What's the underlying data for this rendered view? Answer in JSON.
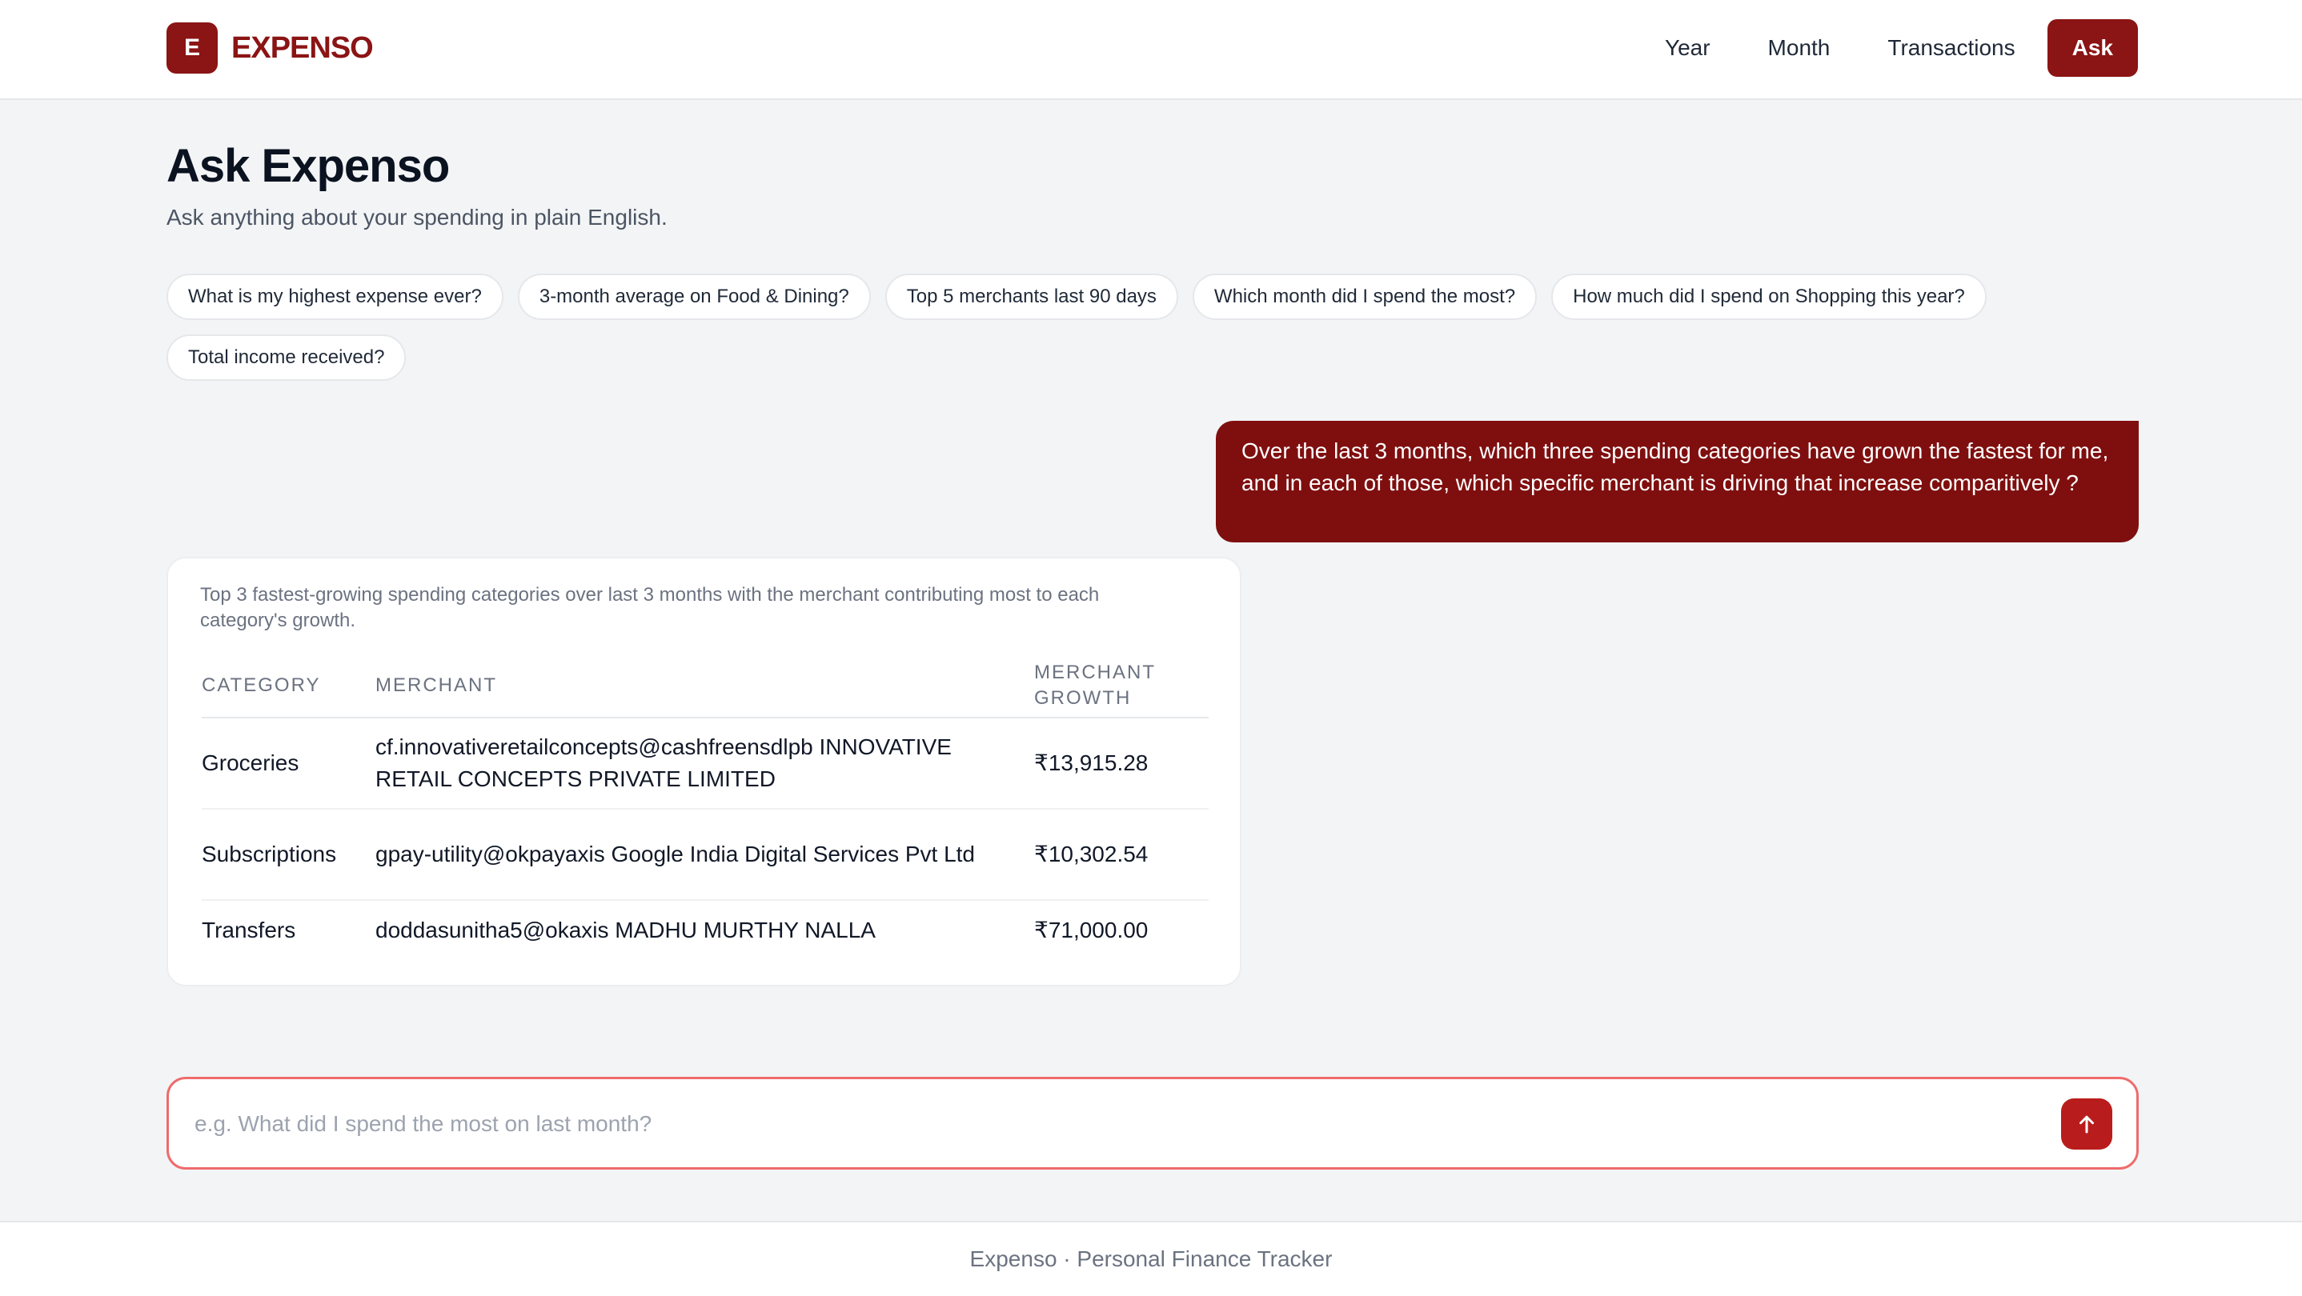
{
  "brand": {
    "logo_letter": "E",
    "name": "EXPENSO",
    "color": "#8b1414"
  },
  "nav": {
    "items": [
      {
        "label": "Year"
      },
      {
        "label": "Month"
      },
      {
        "label": "Transactions"
      },
      {
        "label": "Ask",
        "active": true
      }
    ]
  },
  "page": {
    "title": "Ask Expenso",
    "subtitle": "Ask anything about your spending in plain English."
  },
  "suggestions": [
    "What is my highest expense ever?",
    "3-month average on Food & Dining?",
    "Top 5 merchants last 90 days",
    "Which month did I spend the most?",
    "How much did I spend on Shopping this year?",
    "Total income received?"
  ],
  "conversation": {
    "user_message": "Over the last 3 months, which three spending categories have grown the fastest for me, and in each of those, which specific merchant is driving that increase comparitively ?",
    "answer": {
      "caption": "Top 3 fastest-growing spending categories over last 3 months with the merchant contributing most to each category's growth.",
      "columns": [
        "CATEGORY",
        "MERCHANT",
        "MERCHANT GROWTH"
      ],
      "rows": [
        {
          "category": "Groceries",
          "merchant": "cf.innovativeretailconcepts@cashfreensdlpb INNOVATIVE RETAIL CONCEPTS PRIVATE LIMITED",
          "growth": "₹13,915.28"
        },
        {
          "category": "Subscriptions",
          "merchant": "gpay-utility@okpayaxis Google India Digital Services Pvt Ltd",
          "growth": "₹10,302.54"
        },
        {
          "category": "Transfers",
          "merchant": "doddasunitha5@okaxis MADHU MURTHY NALLA",
          "growth": "₹71,000.00"
        }
      ]
    }
  },
  "input": {
    "value": "",
    "placeholder": "e.g. What did I spend the most on last month?",
    "send_icon": "arrow-up-icon"
  },
  "footer": {
    "text": "Expenso · Personal Finance Tracker"
  },
  "colors": {
    "accent": "#8b1414",
    "input_border": "#ef6b6b",
    "send_button": "#b91c1c"
  }
}
